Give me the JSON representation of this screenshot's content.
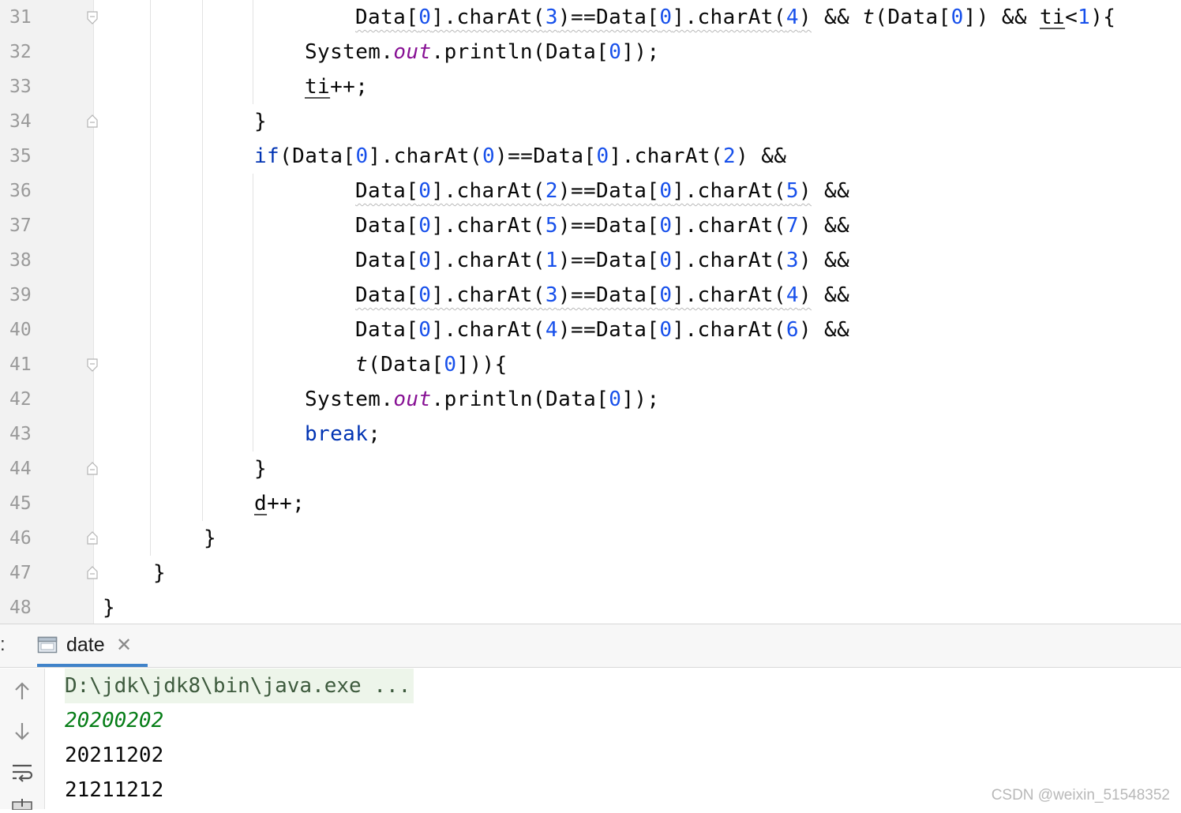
{
  "editor": {
    "line_numbers": [
      "31",
      "32",
      "33",
      "34",
      "35",
      "36",
      "37",
      "38",
      "39",
      "40",
      "41",
      "42",
      "43",
      "44",
      "45",
      "46",
      "47",
      "48"
    ],
    "code": {
      "l31": {
        "a": "Data[",
        "b": "0",
        "c": "].charAt(",
        "d": "3",
        "e": ")==Data[",
        "f": "0",
        "g": "].charAt(",
        "h": "4",
        "i": ")",
        "j": " && ",
        "k": "t",
        "l": "(Data[",
        "m": "0",
        "n": "]) && ",
        "o": "ti",
        "p": "<",
        "q": "1",
        "r": "){"
      },
      "l32": {
        "a": "System.",
        "b": "out",
        "c": ".println(Data[",
        "d": "0",
        "e": "]);"
      },
      "l33": {
        "a": "ti",
        "b": "++;"
      },
      "l34": {
        "a": "}"
      },
      "l35": {
        "a": "if",
        "b": "(Data[",
        "c": "0",
        "d": "].charAt(",
        "e": "0",
        "f": ")==Data[",
        "g": "0",
        "h": "].charAt(",
        "i": "2",
        "j": ") &&"
      },
      "l36": {
        "a": "Data[",
        "b": "0",
        "c": "].charAt(",
        "d": "2",
        "e": ")==Data[",
        "f": "0",
        "g": "].charAt(",
        "h": "5",
        "i": ")",
        "j": " &&"
      },
      "l37": {
        "a": "Data[",
        "b": "0",
        "c": "].charAt(",
        "d": "5",
        "e": ")==Data[",
        "f": "0",
        "g": "].charAt(",
        "h": "7",
        "i": ")",
        "j": " &&"
      },
      "l38": {
        "a": "Data[",
        "b": "0",
        "c": "].charAt(",
        "d": "1",
        "e": ")==Data[",
        "f": "0",
        "g": "].charAt(",
        "h": "3",
        "i": ")",
        "j": " &&"
      },
      "l39": {
        "a": "Data[",
        "b": "0",
        "c": "].charAt(",
        "d": "3",
        "e": ")==Data[",
        "f": "0",
        "g": "].charAt(",
        "h": "4",
        "i": ")",
        "j": " &&"
      },
      "l40": {
        "a": "Data[",
        "b": "0",
        "c": "].charAt(",
        "d": "4",
        "e": ")==Data[",
        "f": "0",
        "g": "].charAt(",
        "h": "6",
        "i": ")",
        "j": " &&"
      },
      "l41": {
        "a": "t",
        "b": "(Data[",
        "c": "0",
        "d": "])){"
      },
      "l42": {
        "a": "System.",
        "b": "out",
        "c": ".println(Data[",
        "d": "0",
        "e": "]);"
      },
      "l43": {
        "a": "break",
        "b": ";"
      },
      "l44": {
        "a": "}"
      },
      "l45": {
        "a": "d",
        "b": "++;"
      },
      "l46": {
        "a": "}"
      },
      "l47": {
        "a": "}"
      },
      "l48": {
        "a": "}"
      }
    }
  },
  "run_panel": {
    "prefix": ":",
    "tab_label": "date",
    "tab_close": "✕",
    "command": "D:\\jdk\\jdk8\\bin\\java.exe ...",
    "output": [
      "20200202",
      "20211202",
      "21211212"
    ]
  },
  "watermark": "CSDN @weixin_51548352",
  "colors": {
    "keyword": "#0033b3",
    "number": "#1750eb",
    "field": "#871094",
    "stdout_first": "#067d17",
    "tab_underline": "#4083c9"
  },
  "icons": {
    "tab": "console-window-icon",
    "toolbar": [
      "arrow-up-icon",
      "arrow-down-icon",
      "soft-wrap-icon",
      "scroll-end-icon"
    ]
  }
}
